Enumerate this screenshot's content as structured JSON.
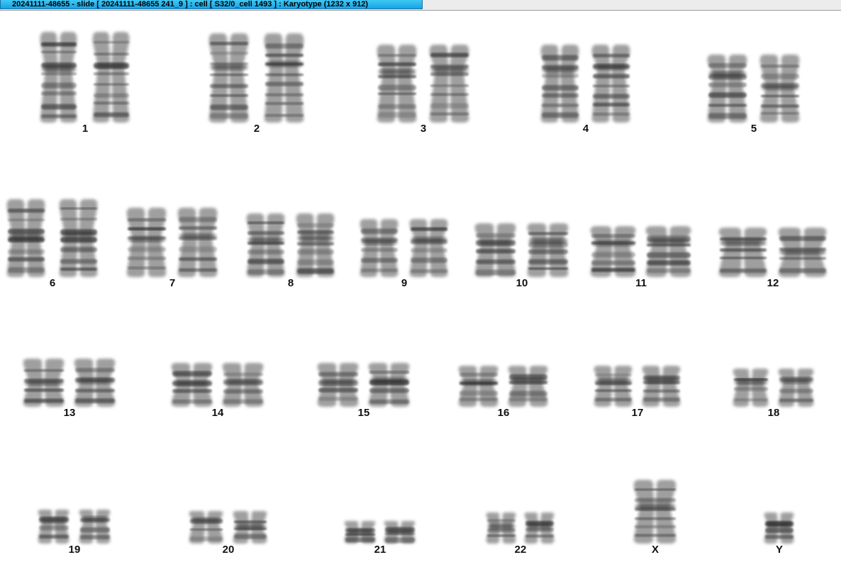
{
  "window": {
    "title": "20241111-48655 - slide [ 20241111-48655 241_9 ] : cell [ S32/0_cell 1493 ] : Karyotype  (1232 x 912)"
  },
  "karyotype": {
    "chromosomes": [
      {
        "label": "1",
        "count": 2
      },
      {
        "label": "2",
        "count": 2
      },
      {
        "label": "3",
        "count": 2
      },
      {
        "label": "4",
        "count": 2
      },
      {
        "label": "5",
        "count": 2
      },
      {
        "label": "6",
        "count": 2
      },
      {
        "label": "7",
        "count": 2
      },
      {
        "label": "8",
        "count": 2
      },
      {
        "label": "9",
        "count": 2
      },
      {
        "label": "10",
        "count": 2
      },
      {
        "label": "11",
        "count": 2
      },
      {
        "label": "12",
        "count": 2
      },
      {
        "label": "13",
        "count": 2
      },
      {
        "label": "14",
        "count": 2
      },
      {
        "label": "15",
        "count": 2
      },
      {
        "label": "16",
        "count": 2
      },
      {
        "label": "17",
        "count": 2
      },
      {
        "label": "18",
        "count": 2
      },
      {
        "label": "19",
        "count": 2
      },
      {
        "label": "20",
        "count": 2
      },
      {
        "label": "21",
        "count": 2
      },
      {
        "label": "22",
        "count": 2
      },
      {
        "label": "X",
        "count": 1
      },
      {
        "label": "Y",
        "count": 1
      }
    ]
  }
}
